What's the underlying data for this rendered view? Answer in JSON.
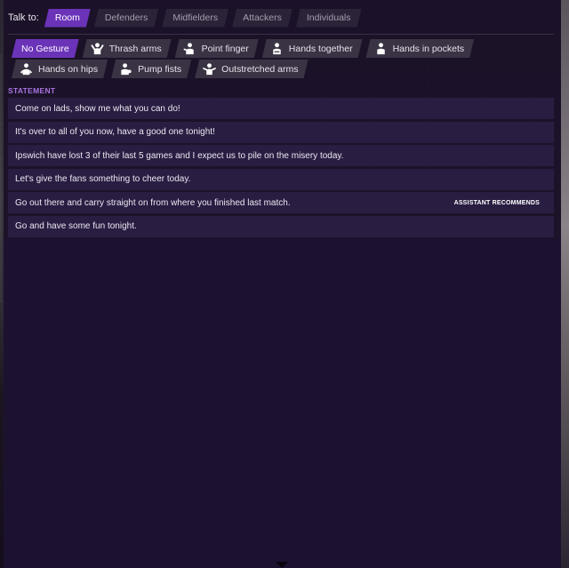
{
  "talk_to": {
    "label": "Talk to:",
    "tabs": [
      {
        "label": "Room",
        "active": true
      },
      {
        "label": "Defenders",
        "active": false
      },
      {
        "label": "Midfielders",
        "active": false
      },
      {
        "label": "Attackers",
        "active": false
      },
      {
        "label": "Individuals",
        "active": false
      }
    ]
  },
  "gestures": [
    {
      "label": "No Gesture",
      "icon": "none",
      "active": true
    },
    {
      "label": "Thrash arms",
      "icon": "thrash-arms-icon",
      "active": false
    },
    {
      "label": "Point finger",
      "icon": "point-finger-icon",
      "active": false
    },
    {
      "label": "Hands together",
      "icon": "hands-together-icon",
      "active": false
    },
    {
      "label": "Hands in pockets",
      "icon": "hands-in-pockets-icon",
      "active": false
    },
    {
      "label": "Hands on hips",
      "icon": "hands-on-hips-icon",
      "active": false
    },
    {
      "label": "Pump fists",
      "icon": "pump-fists-icon",
      "active": false
    },
    {
      "label": "Outstretched arms",
      "icon": "outstretched-arms-icon",
      "active": false
    }
  ],
  "statement_section": {
    "label": "STATEMENT",
    "items": [
      {
        "text": "Come on lads, show me what you can do!",
        "badge": ""
      },
      {
        "text": "It's over to all of you now, have a good one tonight!",
        "badge": ""
      },
      {
        "text": "Ipswich have lost 3 of their last 5 games and I expect us to pile on the misery today.",
        "badge": ""
      },
      {
        "text": "Let's give the fans something to cheer today.",
        "badge": ""
      },
      {
        "text": "Go out there and carry straight on from where you finished last match.",
        "badge": "ASSISTANT RECOMMENDS"
      },
      {
        "text": "Go and have some fun tonight.",
        "badge": ""
      }
    ]
  },
  "colors": {
    "accent": "#6b33b8",
    "statement_bg": "#2a1d42",
    "section_label": "#a874e0"
  }
}
